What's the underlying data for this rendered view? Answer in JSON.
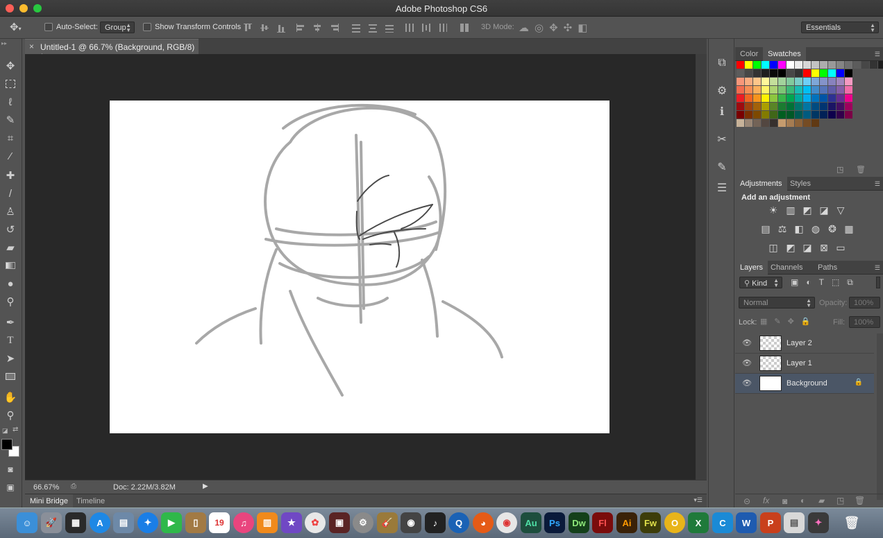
{
  "window": {
    "title": "Adobe Photoshop CS6"
  },
  "options_bar": {
    "auto_select_label": "Auto-Select:",
    "auto_select_value": "Group",
    "show_transform_label": "Show Transform Controls",
    "three_d_mode_label": "3D Mode:",
    "workspace_value": "Essentials"
  },
  "document": {
    "tab_title": "Untitled-1 @ 66.7% (Background, RGB/8) *"
  },
  "status": {
    "zoom": "66.67%",
    "doc_size": "Doc: 2.22M/3.82M"
  },
  "bottom_tabs": {
    "mini_bridge": "Mini Bridge",
    "timeline": "Timeline"
  },
  "color_panel": {
    "tab_color": "Color",
    "tab_swatches": "Swatches"
  },
  "adjustments_panel": {
    "tab_adjustments": "Adjustments",
    "tab_styles": "Styles",
    "heading": "Add an adjustment"
  },
  "layers_panel": {
    "tab_layers": "Layers",
    "tab_channels": "Channels",
    "tab_paths": "Paths",
    "filter_value": "Kind",
    "blend_mode": "Normal",
    "opacity_label": "Opacity:",
    "opacity_value": "100%",
    "lock_label": "Lock:",
    "fill_label": "Fill:",
    "fill_value": "100%",
    "layers": [
      {
        "name": "Layer 2",
        "visible": true,
        "selected": false
      },
      {
        "name": "Layer 1",
        "visible": true,
        "selected": false
      },
      {
        "name": "Background",
        "visible": true,
        "selected": true,
        "locked": true
      }
    ]
  },
  "colors": {
    "foreground": "#000000",
    "background": "#ffffff",
    "selected_layer": "#4b5666"
  },
  "dock": {
    "app_labels": [
      "Au",
      "Ps",
      "Dw",
      "Fl",
      "Ai",
      "Fw"
    ],
    "calendar_day": "19"
  }
}
